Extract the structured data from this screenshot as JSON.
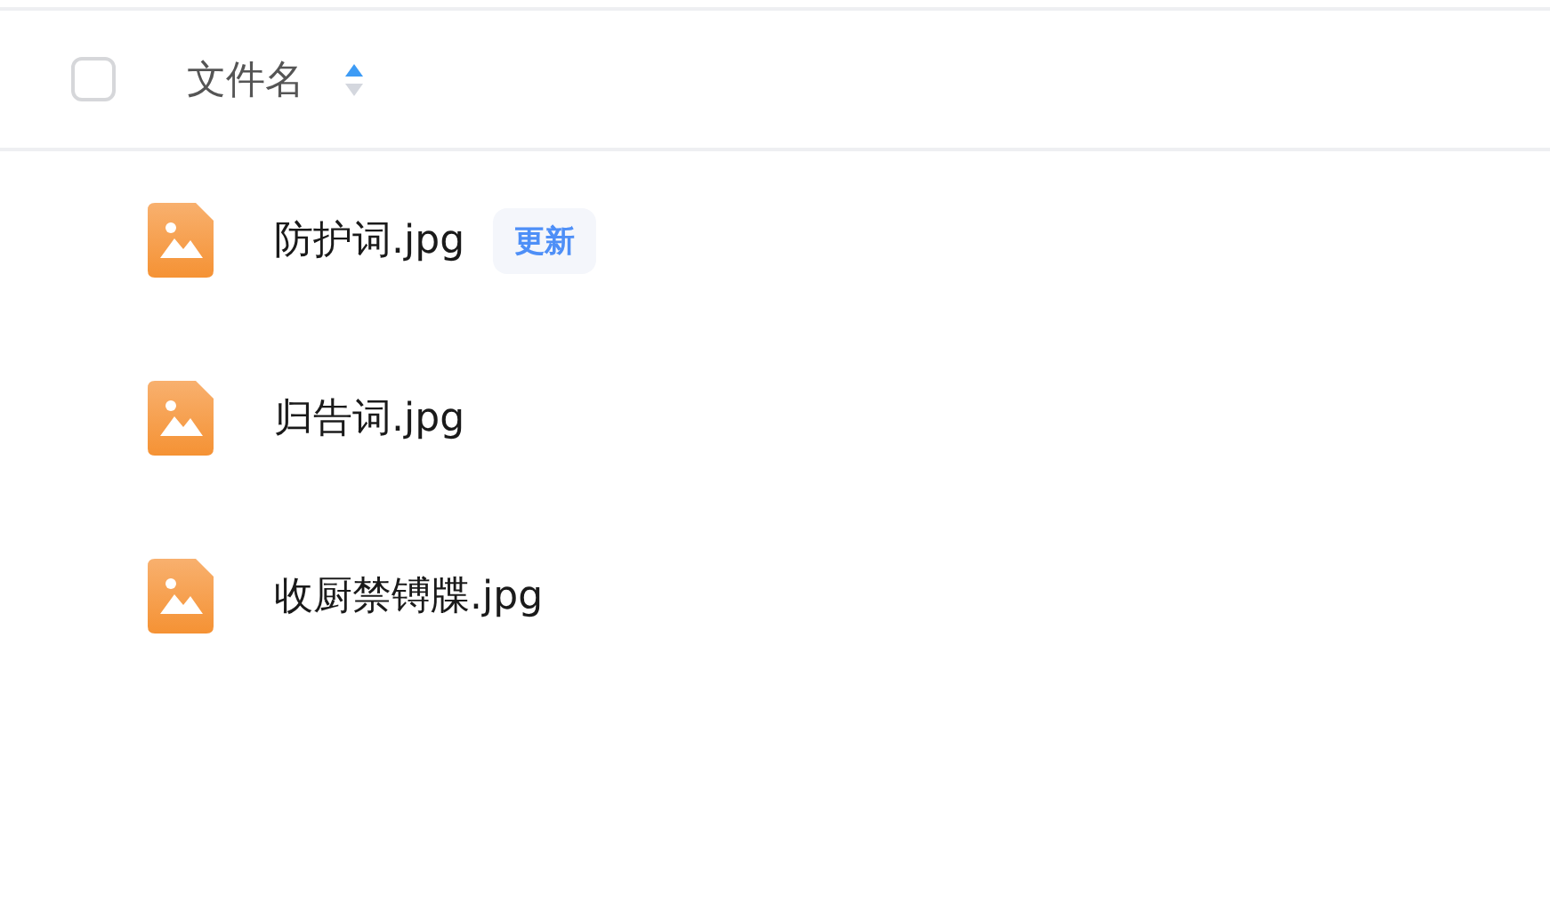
{
  "header": {
    "select_all": {
      "checked": false
    },
    "label": "文件名",
    "sorted_ascending": true
  },
  "files": [
    {
      "name": "防护词.jpg",
      "badge": "更新"
    },
    {
      "name": "归告词.jpg"
    },
    {
      "name": "收厨禁镈牒.jpg"
    }
  ]
}
